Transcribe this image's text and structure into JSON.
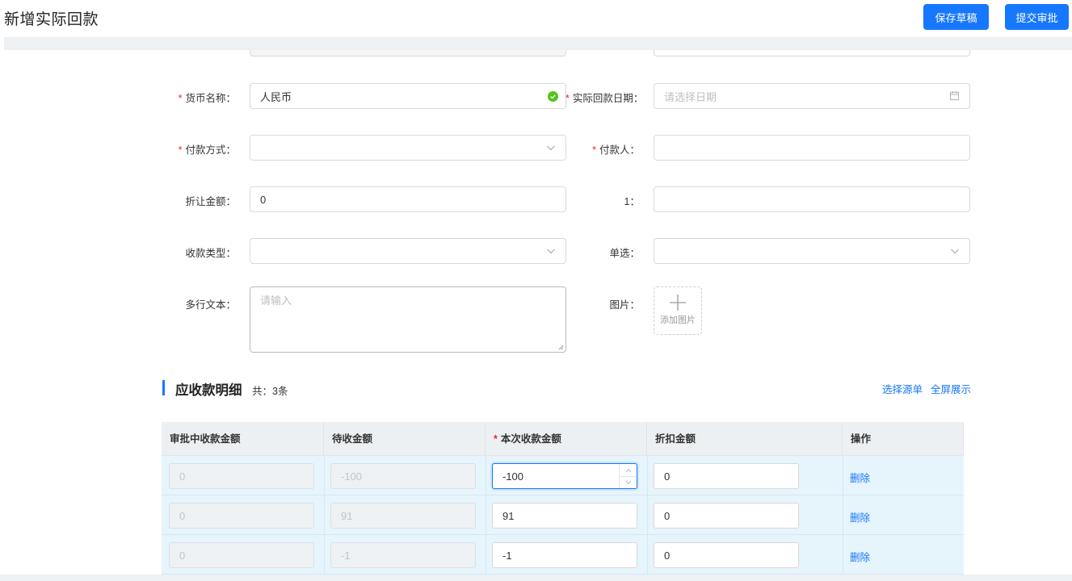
{
  "header": {
    "title": "新增实际回款",
    "save_draft_label": "保存草稿",
    "submit_label": "提交审批"
  },
  "form": {
    "currency": {
      "label": "货币名称",
      "value": "人民币",
      "required": true
    },
    "actual_date": {
      "label": "实际回款日期",
      "placeholder": "请选择日期",
      "required": true
    },
    "payment_method": {
      "label": "付款方式",
      "value": "",
      "required": true
    },
    "payer": {
      "label": "付款人",
      "value": "",
      "required": true
    },
    "discount_amount": {
      "label": "折让金额",
      "value": "0"
    },
    "field_1": {
      "label": "1",
      "value": ""
    },
    "receipt_type": {
      "label": "收款类型",
      "value": ""
    },
    "single_select": {
      "label": "单选",
      "value": ""
    },
    "multiline_text": {
      "label": "多行文本",
      "placeholder": "请输入"
    },
    "image": {
      "label": "图片",
      "upload_label": "添加图片"
    }
  },
  "detail_section": {
    "title": "应收款明细",
    "count_text": "共：3条",
    "select_source_label": "选择源单",
    "fullscreen_label": "全屏展示",
    "columns": [
      "审批中收款金额",
      "待收金额",
      "本次收款金额",
      "折扣金额",
      "操作"
    ],
    "required_column": "本次收款金额",
    "rows": [
      {
        "approving": "0",
        "pending": "-100",
        "current": "-100",
        "discount": "0",
        "action": "删除"
      },
      {
        "approving": "0",
        "pending": "91",
        "current": "91",
        "discount": "0",
        "action": "删除"
      },
      {
        "approving": "0",
        "pending": "-1",
        "current": "-1",
        "discount": "0",
        "action": "删除"
      }
    ]
  },
  "colors": {
    "primary": "#1677ff",
    "required": "#f5222d",
    "success": "#52c41a",
    "row_bg": "#e6f4fc"
  }
}
